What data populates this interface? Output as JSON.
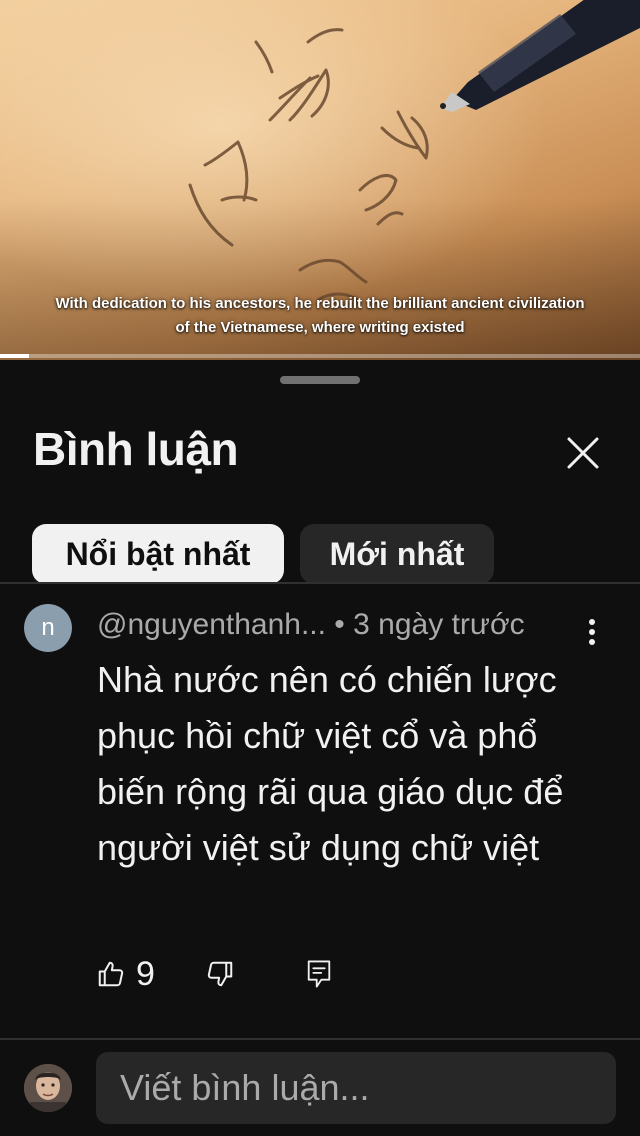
{
  "video": {
    "subtitle_line1": "With dedication to his ancestors, he rebuilt the brilliant ancient civilization",
    "subtitle_line2": "of the Vietnamese, where writing existed",
    "progress": 0.045
  },
  "comments_panel": {
    "title": "Bình luận",
    "filters": [
      {
        "label": "Nổi bật nhất",
        "selected": true
      },
      {
        "label": "Mới nhất",
        "selected": false
      }
    ],
    "comments": [
      {
        "avatar_letter": "n",
        "author": "@nguyenthanh...",
        "separator": " • ",
        "time": "3 ngày trước",
        "text": "Nhà nước nên có chiến lược phục hồi chữ việt cổ và phổ biến rộng rãi  qua giáo dục để người việt sử dụng chữ việt",
        "likes": "9"
      }
    ],
    "input_placeholder": "Viết bình luận..."
  },
  "icons": {
    "close": "close-icon",
    "more": "more-vertical-icon",
    "like": "thumbs-up-icon",
    "dislike": "thumbs-down-icon",
    "reply": "reply-comment-icon"
  },
  "colors": {
    "background": "#0f0f0f",
    "chip_active_bg": "#f1f1f1",
    "chip_inactive_bg": "#272727",
    "secondary_text": "#aaaaaa",
    "avatar_bg": "#8a9eae"
  }
}
